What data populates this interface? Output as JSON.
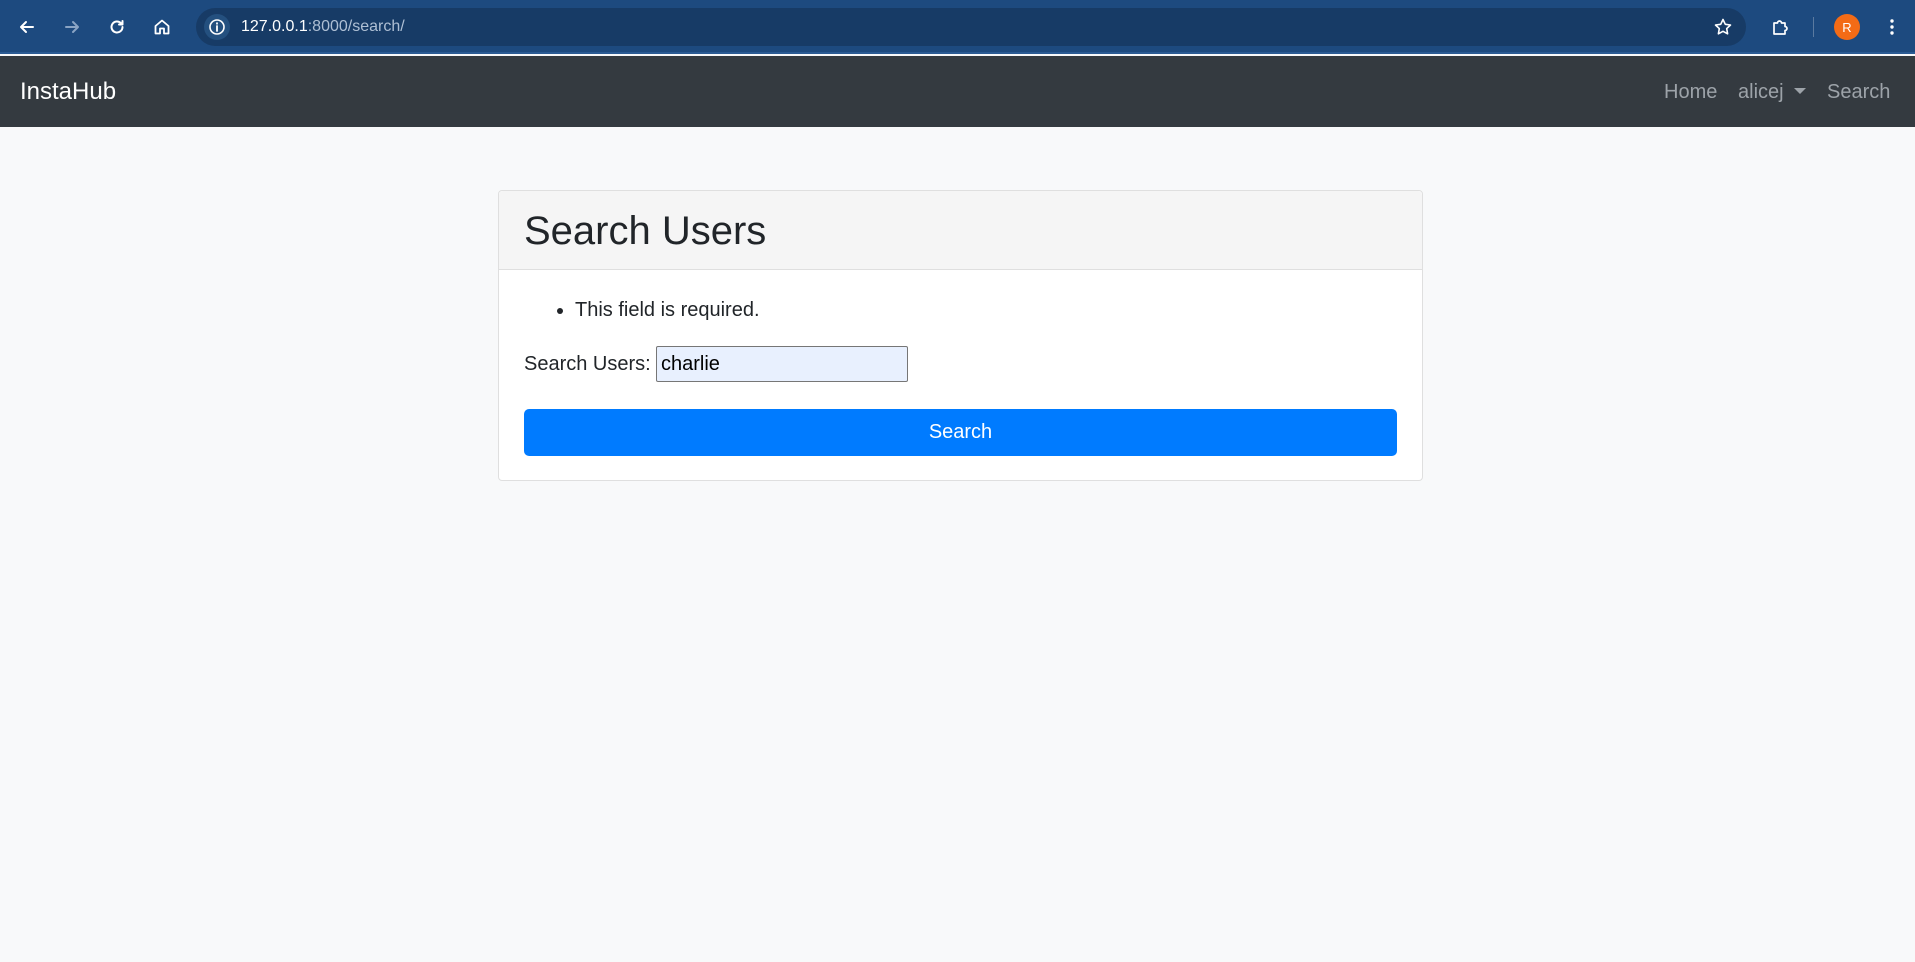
{
  "browser": {
    "url_host": "127.0.0.1",
    "url_path": ":8000/search/",
    "profile_initial": "R"
  },
  "navbar": {
    "brand": "InstaHub",
    "links": {
      "home": "Home",
      "user": "alicej",
      "search": "Search"
    }
  },
  "card": {
    "title": "Search Users",
    "errors": [
      "This field is required."
    ],
    "field_label": "Search Users:",
    "field_value": "charlie",
    "submit_label": "Search"
  },
  "colors": {
    "browser_chrome": "#1d4a7f",
    "navbar": "#343a40",
    "primary_button": "#007bff",
    "page_bg": "#f8f9fa",
    "avatar": "#f36b16"
  }
}
